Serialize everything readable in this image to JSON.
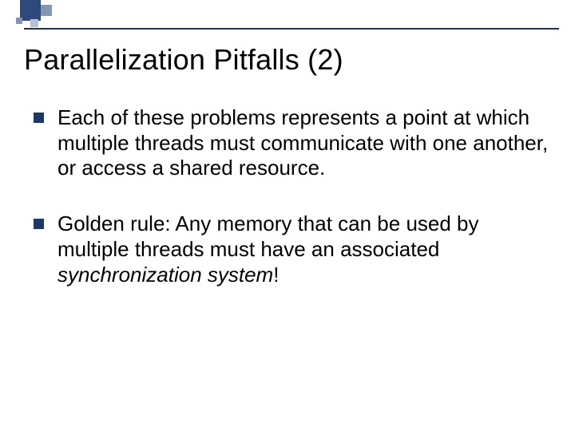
{
  "slide": {
    "title": "Parallelization Pitfalls (2)",
    "bullets": [
      {
        "text": "Each of these problems represents a point at which multiple threads must communicate with one another, or access a shared resource."
      },
      {
        "prefix": "Golden rule: Any memory that can be used by multiple threads must have an associated ",
        "emphasis": "synchronization system",
        "suffix": "!"
      }
    ]
  }
}
